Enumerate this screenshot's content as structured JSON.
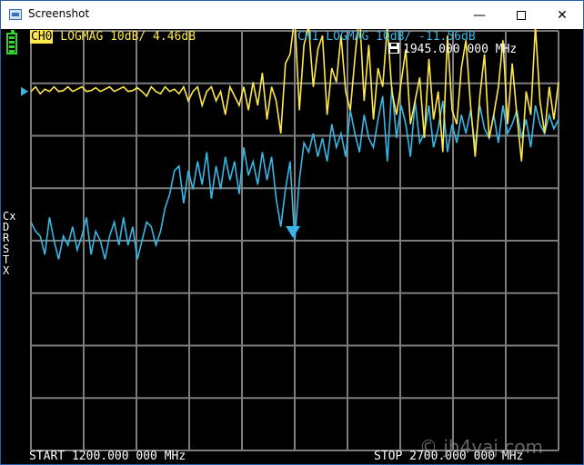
{
  "window": {
    "title": "Screenshot",
    "minimize": "—",
    "close": "✕"
  },
  "header": {
    "ch0_badge": "CH0",
    "ch0_rest": " LOGMAG 10dB/ 4.46dB",
    "ch1_label": "CH1 LOGMAG 10dB/ -11.56dB",
    "marker_freq": "1945.000 000 MHz"
  },
  "side_menu": [
    "Cx",
    "D",
    "R",
    "S",
    "T",
    "X"
  ],
  "footer": {
    "start": "START 1200.000 000 MHz",
    "stop": "STOP 2700.000 000 MHz"
  },
  "watermark": "© jh4vaj.com",
  "colors": {
    "ch0": "#ffe84a",
    "ch1": "#38b7e6",
    "grid": "#7c7c7c",
    "battery": "#2fd52f"
  },
  "chart_data": {
    "type": "line",
    "x_start": 1200,
    "x_stop": 2700,
    "marker_x": 1945,
    "series": [
      {
        "name": "CH0",
        "values": [
          -0.3,
          -0.2,
          -0.35,
          -0.25,
          -0.3,
          -0.2,
          -0.3,
          -0.28,
          -0.2,
          -0.3,
          -0.25,
          -0.2,
          -0.3,
          -0.28,
          -0.22,
          -0.3,
          -0.25,
          -0.2,
          -0.3,
          -0.25,
          -0.2,
          -0.3,
          -0.28,
          -0.22,
          -0.3,
          -0.4,
          -0.2,
          -0.3,
          -0.35,
          -0.2,
          -0.3,
          -0.25,
          -0.35,
          -0.2,
          -0.5,
          -0.3,
          -0.2,
          -0.6,
          -0.3,
          -0.2,
          -0.5,
          -0.3,
          -0.8,
          -0.2,
          -0.4,
          -0.6,
          -0.2,
          -0.7,
          -0.1,
          -0.6,
          0.1,
          -0.9,
          -0.2,
          -0.5,
          -1.2,
          0.3,
          0.5,
          1.3,
          -0.7,
          0.7,
          1.1,
          -0.2,
          0.6,
          0.9,
          -0.8,
          0.2,
          -0.1,
          0.9,
          -0.3,
          -0.7,
          0.4,
          1.4,
          -0.5,
          0.7,
          -0.9,
          0.2,
          -0.2,
          1.1,
          -0.3,
          -0.8,
          -0.1,
          0.6,
          -1.0,
          -0.5,
          0.0,
          -1.3,
          0.4,
          -0.9,
          -0.3,
          -1.6,
          0.9,
          -0.7,
          -1.0,
          0.2,
          0.8,
          -0.6,
          -1.7,
          -0.4,
          0.5,
          -1.3,
          -0.8,
          -0.2,
          0.8,
          -1.0,
          0.3,
          -0.8,
          -1.8,
          -0.3,
          -0.8,
          1.1,
          -0.5,
          -1.2,
          -0.2,
          -0.9,
          -0.1
        ]
      },
      {
        "name": "CH1",
        "values": [
          -3.1,
          -3.3,
          -3.4,
          -3.8,
          -3.0,
          -3.5,
          -3.9,
          -3.4,
          -3.6,
          -3.2,
          -3.7,
          -3.4,
          -3.0,
          -3.8,
          -3.3,
          -3.5,
          -3.9,
          -3.4,
          -3.1,
          -3.6,
          -3.0,
          -3.6,
          -3.2,
          -3.9,
          -3.5,
          -3.1,
          -3.2,
          -3.6,
          -3.3,
          -2.8,
          -2.5,
          -2.0,
          -1.9,
          -2.7,
          -2.0,
          -2.4,
          -1.8,
          -2.3,
          -1.6,
          -2.6,
          -1.9,
          -2.4,
          -1.7,
          -2.2,
          -1.8,
          -2.5,
          -1.5,
          -2.1,
          -1.8,
          -2.3,
          -1.6,
          -2.2,
          -1.7,
          -2.6,
          -3.2,
          -2.4,
          -1.8,
          -3.5,
          -2.2,
          -1.4,
          -1.6,
          -1.2,
          -1.7,
          -1.3,
          -1.8,
          -1.0,
          -1.5,
          -1.2,
          -1.7,
          -0.7,
          -1.2,
          -1.6,
          -0.8,
          -1.3,
          -1.5,
          -0.9,
          -0.4,
          -1.8,
          -0.2,
          -1.3,
          -0.6,
          -1.0,
          -1.7,
          -0.5,
          -1.4,
          -1.2,
          -0.6,
          -1.5,
          -1.1,
          -0.5,
          -1.6,
          -1.0,
          -1.4,
          -0.8,
          -1.2,
          -0.7,
          -1.5,
          -0.6,
          -1.1,
          -1.3,
          -0.8,
          -1.4,
          -0.6,
          -1.2,
          -1.0,
          -0.7,
          -1.3,
          -0.9,
          -1.5,
          -0.6,
          -1.0,
          -1.2,
          -0.8,
          -1.1,
          -0.9
        ]
      }
    ],
    "ylim": [
      -8,
      1
    ],
    "grid": true
  }
}
